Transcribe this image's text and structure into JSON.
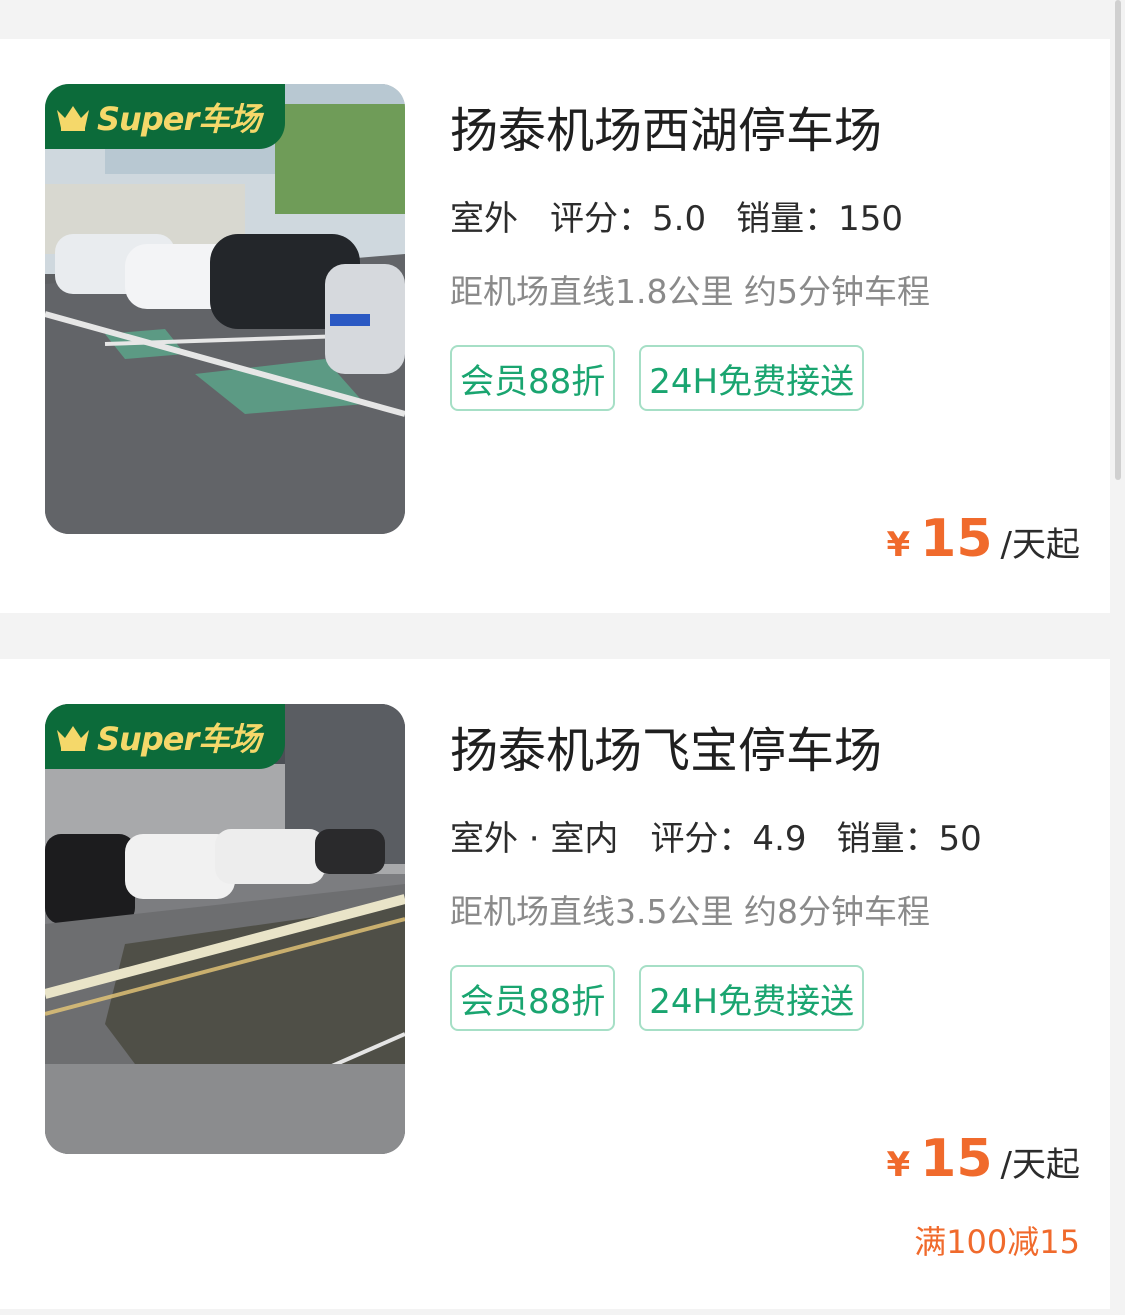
{
  "listings": [
    {
      "badge": "Super车场",
      "title": "扬泰机场西湖停车场",
      "location_type": "室外",
      "rating_label": "评分：5.0",
      "sales_label": "销量：150",
      "distance": "距机场直线1.8公里 约5分钟车程",
      "tags": [
        "会员88折",
        "24H免费接送"
      ],
      "price_symbol": "¥",
      "price_value": "15",
      "price_unit": "/天起",
      "promo": ""
    },
    {
      "badge": "Super车场",
      "title": "扬泰机场飞宝停车场",
      "location_type": "室外 · 室内",
      "rating_label": "评分：4.9",
      "sales_label": "销量：50",
      "distance": "距机场直线3.5公里 约8分钟车程",
      "tags": [
        "会员88折",
        "24H免费接送"
      ],
      "price_symbol": "¥",
      "price_value": "15",
      "price_unit": "/天起",
      "promo": "满100减15"
    }
  ],
  "colors": {
    "accent_green": "#1aa570",
    "badge_green": "#0c6b3a",
    "badge_gold": "#f5d86a",
    "price_orange": "#f06a2c"
  },
  "icons": {
    "badge_icon": "crown-icon"
  }
}
